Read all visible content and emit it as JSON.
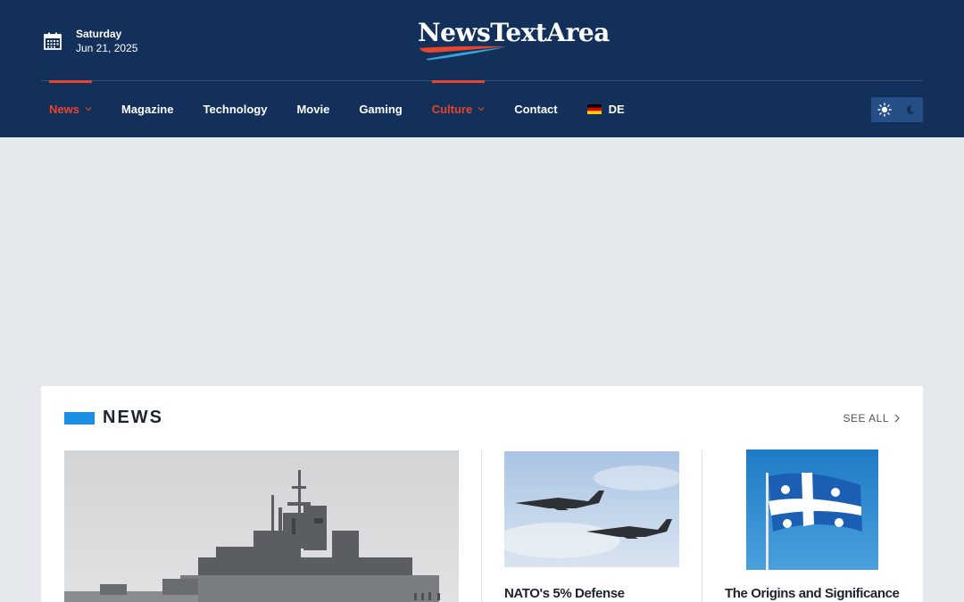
{
  "header": {
    "date": {
      "day_of_week": "Saturday",
      "date": "Jun 21, 2025"
    },
    "logo_text": "NewsTextArea",
    "nav": [
      {
        "label": "News",
        "active": true,
        "has_dropdown": true
      },
      {
        "label": "Magazine",
        "active": false,
        "has_dropdown": false
      },
      {
        "label": "Technology",
        "active": false,
        "has_dropdown": false
      },
      {
        "label": "Movie",
        "active": false,
        "has_dropdown": false
      },
      {
        "label": "Gaming",
        "active": false,
        "has_dropdown": false
      },
      {
        "label": "Culture",
        "active": true,
        "has_dropdown": true
      },
      {
        "label": "Contact",
        "active": false,
        "has_dropdown": false
      },
      {
        "label": "DE",
        "icon": "germany-flag-icon"
      }
    ],
    "theme_toggle": {
      "light_icon": "sun-icon",
      "dark_icon": "moon-icon"
    }
  },
  "news_section": {
    "title": "NEWS",
    "see_all_label": "SEE ALL",
    "articles": [
      {
        "image": "warship-image",
        "title": ""
      },
      {
        "image": "fighter-jets-image",
        "title": "NATO's 5% Defense"
      },
      {
        "image": "quebec-flag-image",
        "title": "The Origins and Significance"
      }
    ]
  },
  "colors": {
    "header_bg": "#12305a",
    "accent_red": "#e8452c",
    "accent_blue": "#1a8fe3",
    "page_bg": "#e5e8ec"
  }
}
